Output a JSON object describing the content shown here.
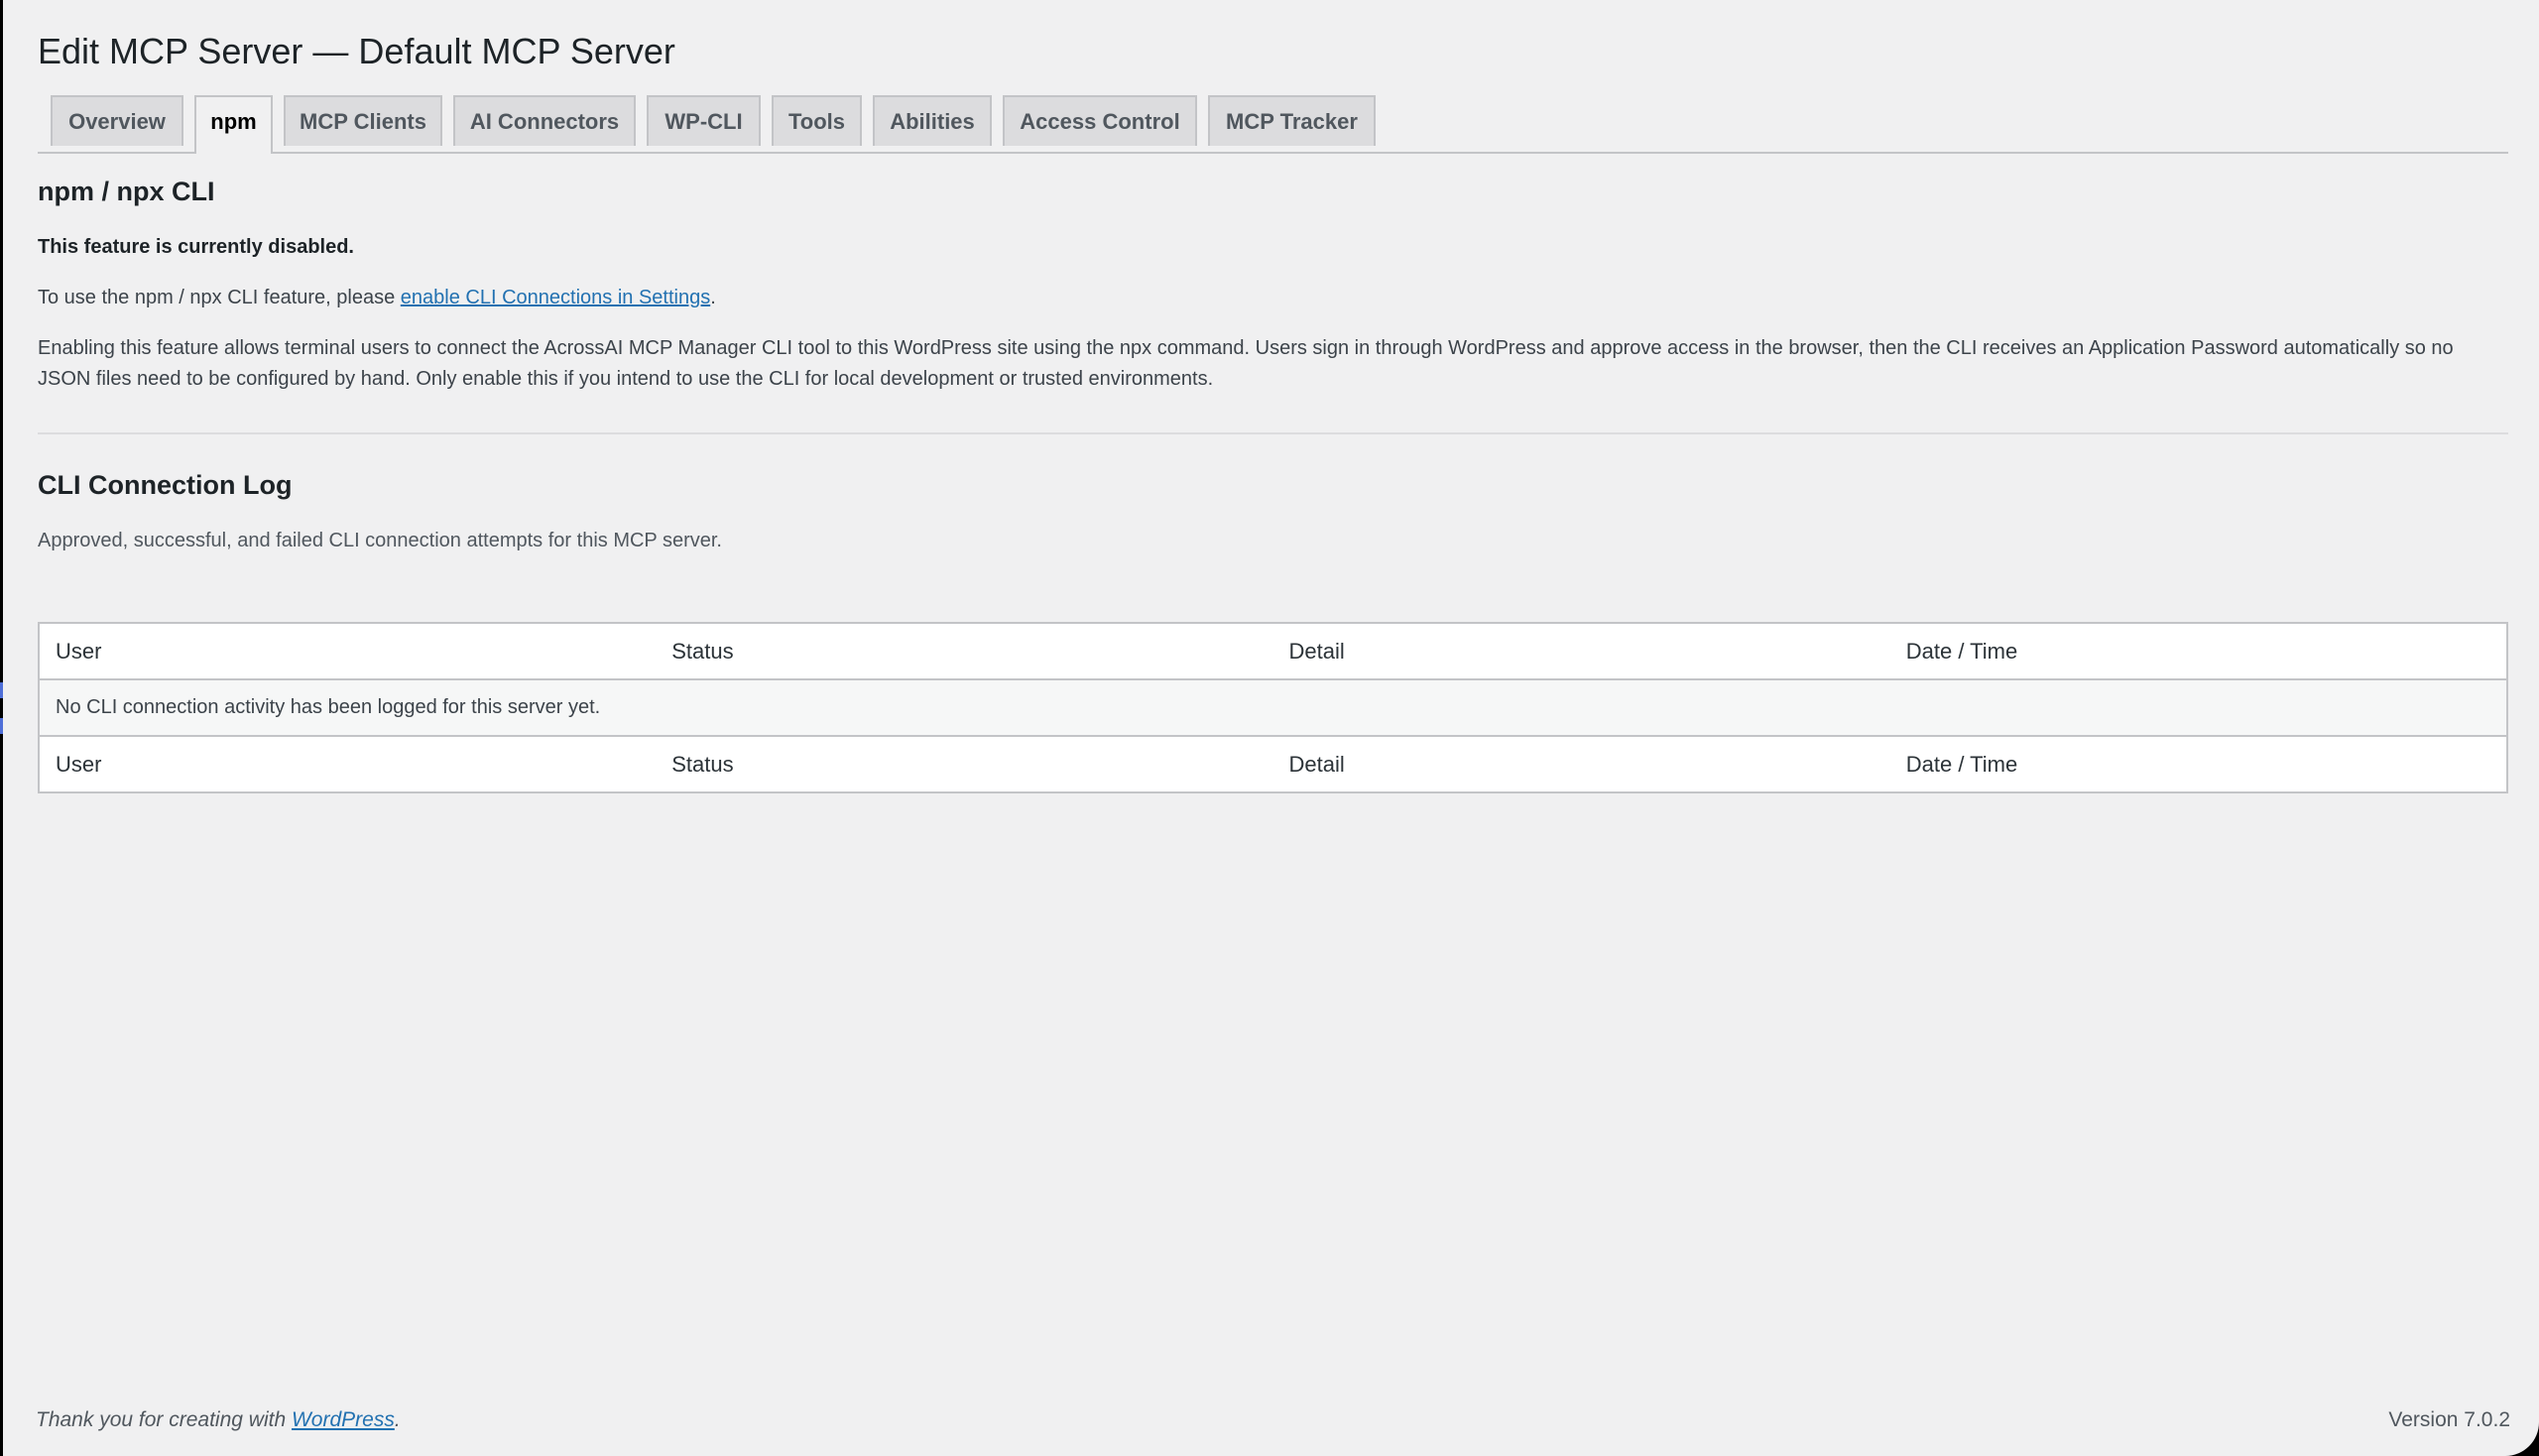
{
  "page": {
    "title": "Edit MCP Server — Default MCP Server"
  },
  "tabs": [
    {
      "label": "Overview",
      "active": false
    },
    {
      "label": "npm",
      "active": true
    },
    {
      "label": "MCP Clients",
      "active": false
    },
    {
      "label": "AI Connectors",
      "active": false
    },
    {
      "label": "WP-CLI",
      "active": false
    },
    {
      "label": "Tools",
      "active": false
    },
    {
      "label": "Abilities",
      "active": false
    },
    {
      "label": "Access Control",
      "active": false
    },
    {
      "label": "MCP Tracker",
      "active": false
    }
  ],
  "npm_section": {
    "heading": "npm / npx CLI",
    "disabled_notice": "This feature is currently disabled.",
    "instruction_prefix": "To use the npm / npx CLI feature, please ",
    "instruction_link": "enable CLI Connections in Settings",
    "instruction_suffix": ".",
    "description": "Enabling this feature allows terminal users to connect the AcrossAI MCP Manager CLI tool to this WordPress site using the npx command. Users sign in through WordPress and approve access in the browser, then the CLI receives an Application Password automatically so no JSON files need to be configured by hand. Only enable this if you intend to use the CLI for local development or trusted environments."
  },
  "log_section": {
    "heading": "CLI Connection Log",
    "description": "Approved, successful, and failed CLI connection attempts for this MCP server.",
    "columns": [
      "User",
      "Status",
      "Detail",
      "Date / Time"
    ],
    "empty_message": "No CLI connection activity has been logged for this server yet."
  },
  "footer": {
    "thanks_prefix": "Thank you for creating with ",
    "thanks_link": "WordPress",
    "thanks_suffix": ".",
    "version": "Version 7.0.2"
  },
  "colors": {
    "background": "#f0f0f1",
    "link": "#2271b1",
    "border": "#c3c4c7"
  }
}
